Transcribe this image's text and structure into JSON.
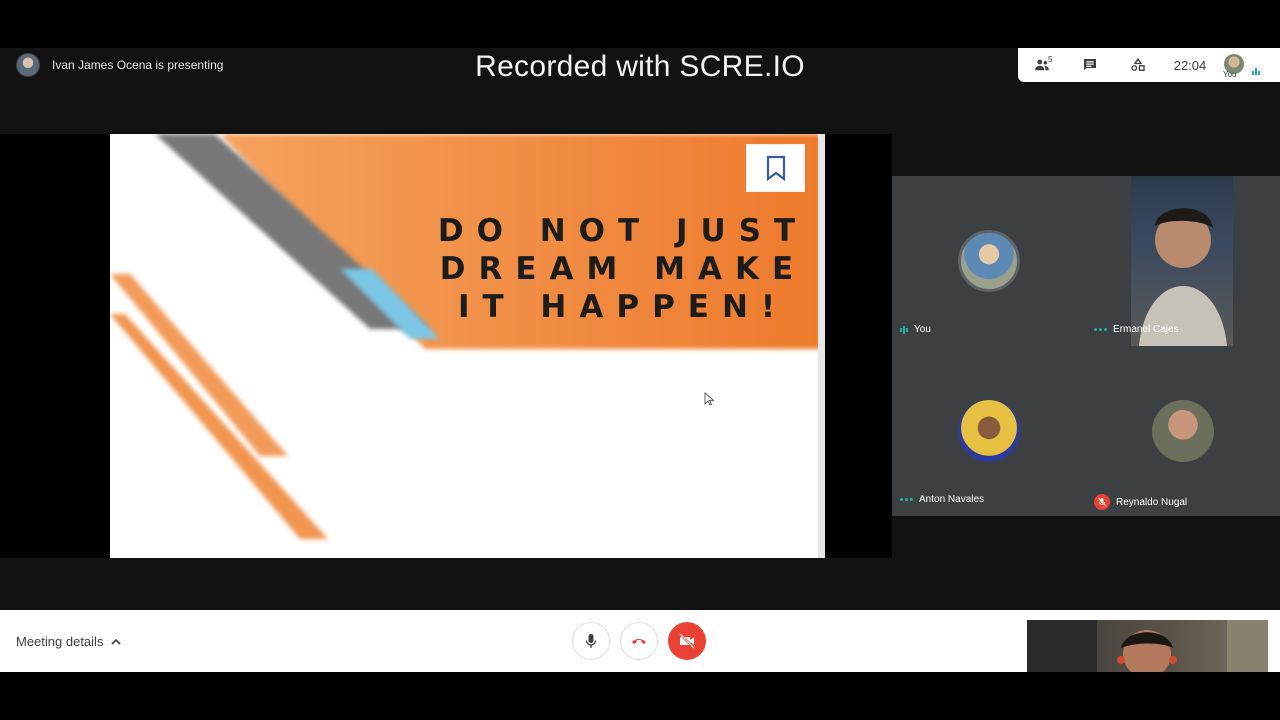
{
  "watermark": "Recorded with SCRE.IO",
  "presenter": {
    "text": "Ivan James Ocena is presenting"
  },
  "topbar": {
    "people_count": "5",
    "time": "22:04",
    "self_label": "You"
  },
  "slide": {
    "lines": [
      "DO NOT JUST",
      "DREAM MAKE",
      "IT HAPPEN!"
    ]
  },
  "participants": [
    {
      "name": "You",
      "indicator": "speaking-bars"
    },
    {
      "name": "Ermanel Cajes",
      "indicator": "dots"
    },
    {
      "name": "Anton Navales",
      "indicator": "dots"
    },
    {
      "name": "Reynaldo Nugal",
      "indicator": "mic-off"
    }
  ],
  "bottombar": {
    "meeting_details": "Meeting details"
  },
  "colors": {
    "accent_green": "#1db398",
    "end_red": "#ea4335",
    "slide_orange": "#f08a3c"
  }
}
